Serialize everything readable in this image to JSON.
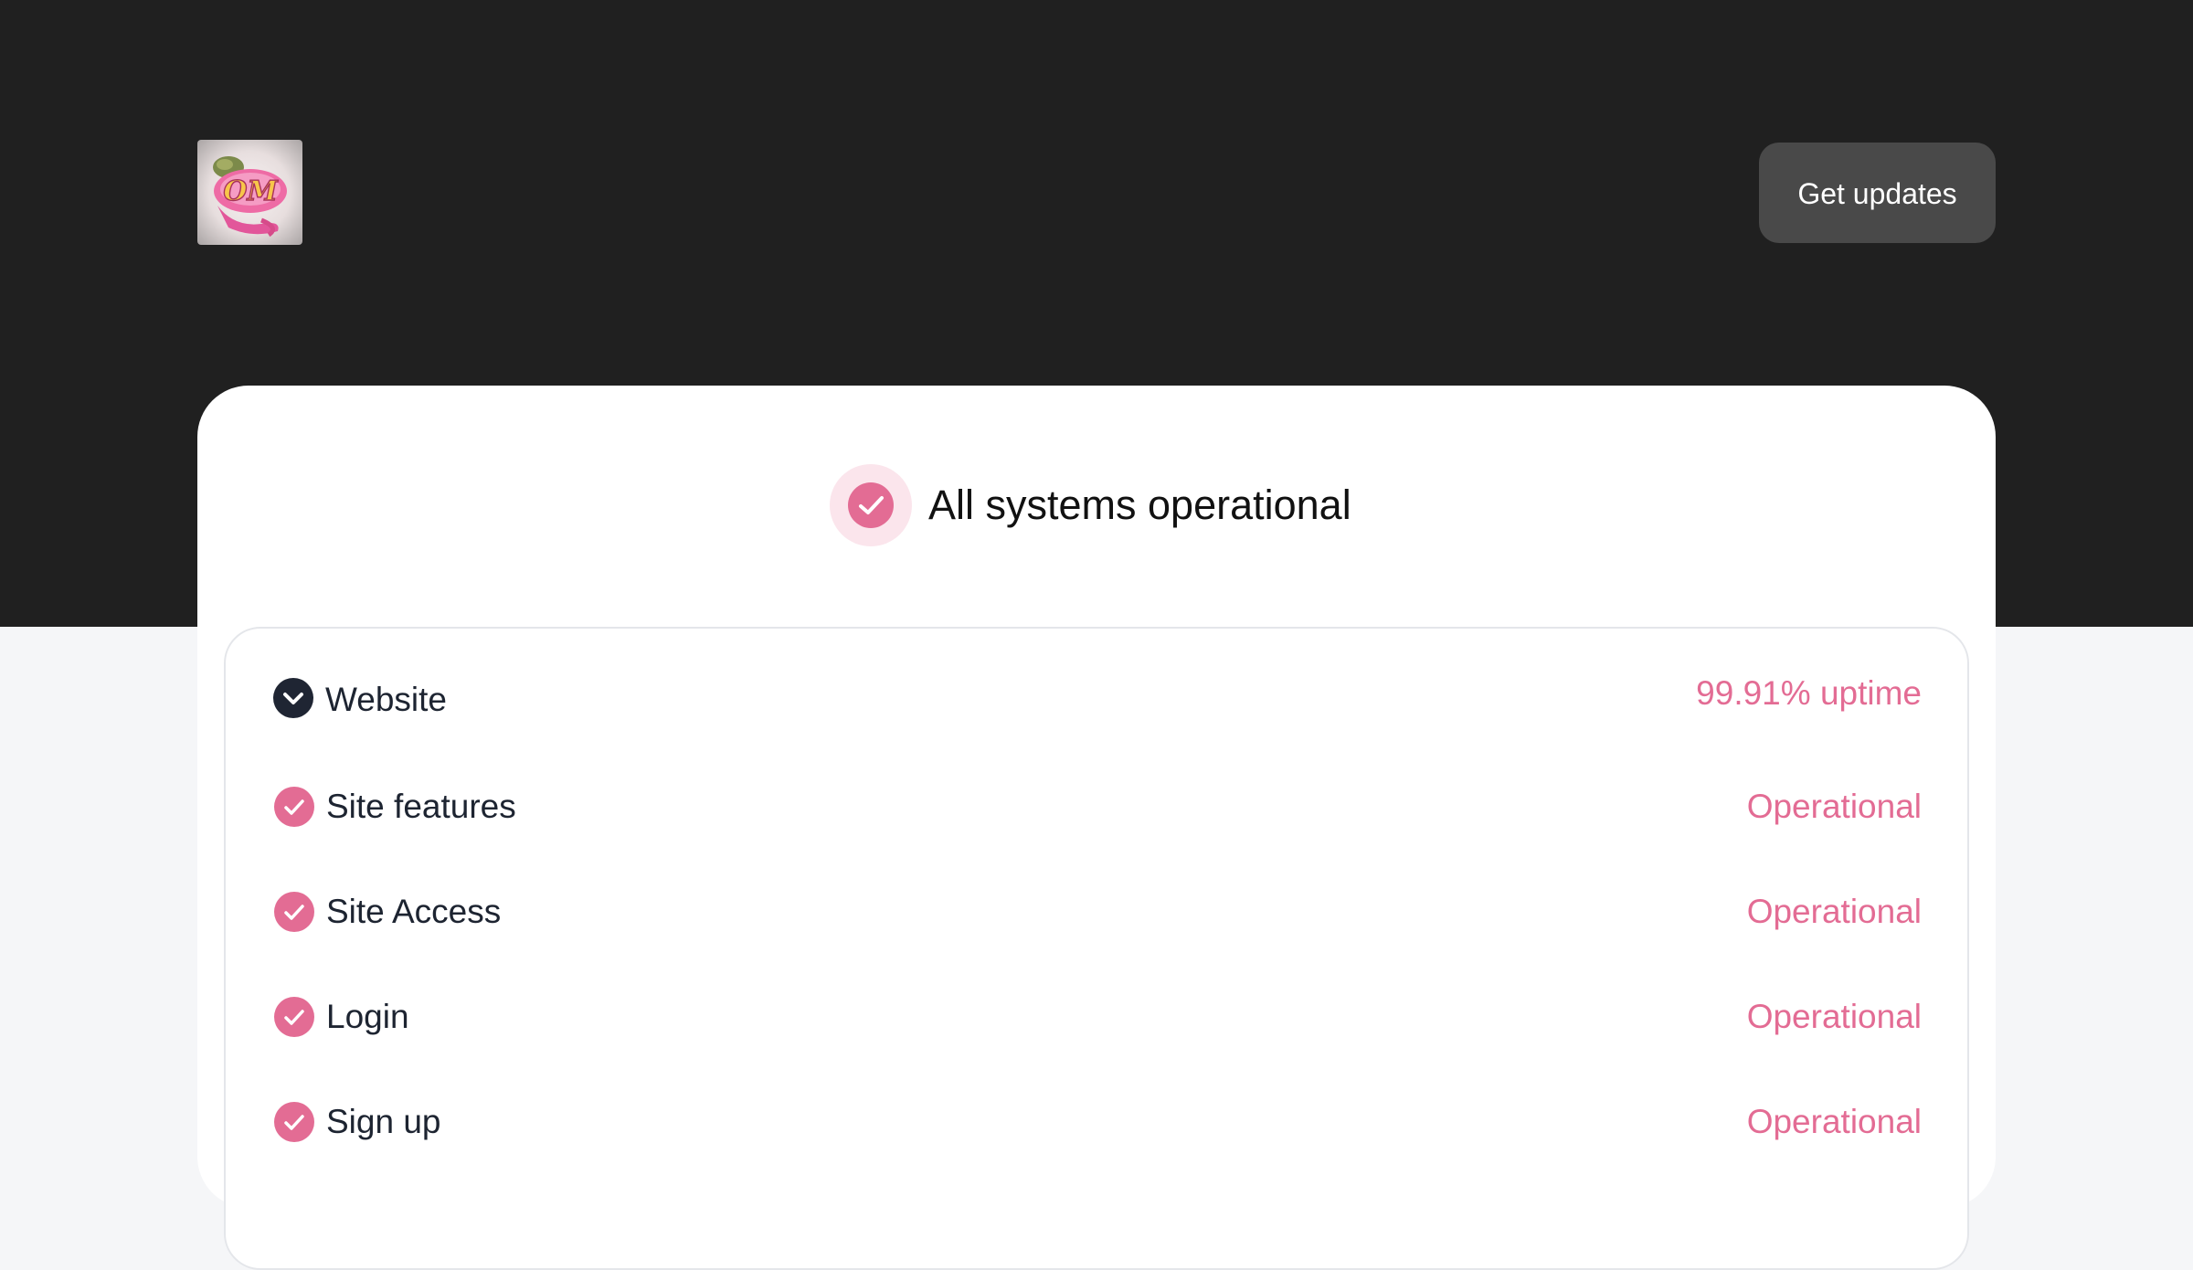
{
  "header": {
    "logo_text": "OM",
    "get_updates_label": "Get updates"
  },
  "overall_status": {
    "text": "All systems operational",
    "icon": "check-circle-icon"
  },
  "group": {
    "name": "Website",
    "uptime": "99.91% uptime",
    "expand_icon": "chevron-down-icon"
  },
  "components": [
    {
      "name": "Site features",
      "status": "Operational"
    },
    {
      "name": "Site Access",
      "status": "Operational"
    },
    {
      "name": "Login",
      "status": "Operational"
    },
    {
      "name": "Sign up",
      "status": "Operational"
    }
  ],
  "colors": {
    "hero_background": "#202020",
    "accent": "#e36c94",
    "button_background": "#494949",
    "page_background": "#f5f6f8"
  }
}
